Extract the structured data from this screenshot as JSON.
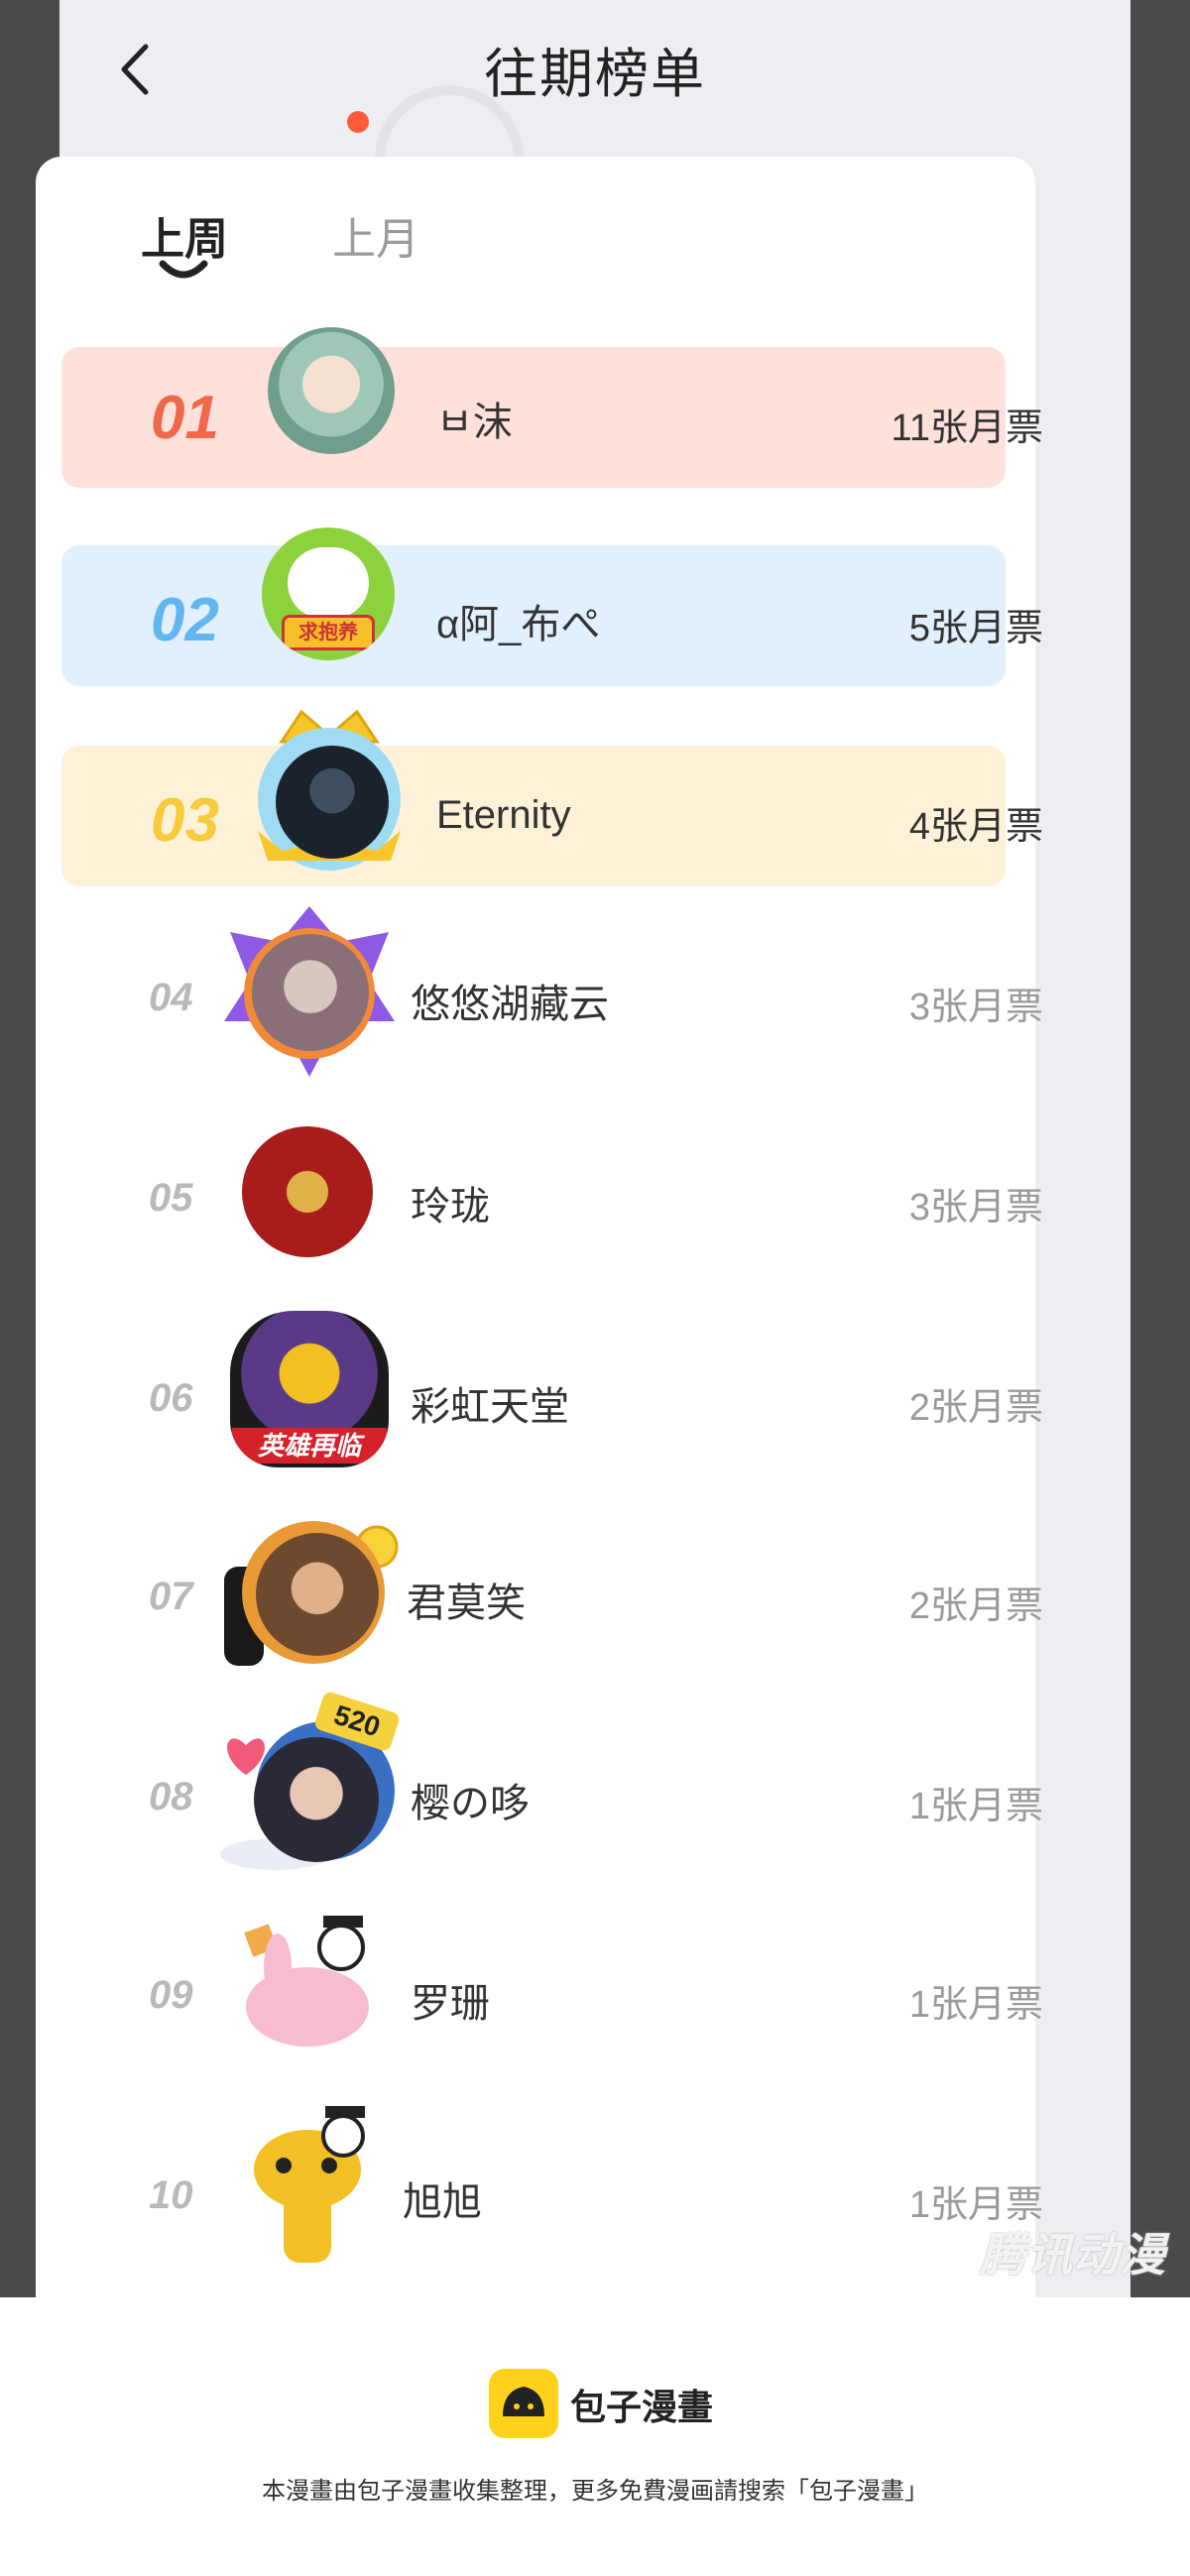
{
  "header": {
    "title": "往期榜单",
    "back_icon": "chevron-left-icon"
  },
  "tabs": [
    {
      "label": "上周",
      "selected": true
    },
    {
      "label": "上月",
      "selected": false
    }
  ],
  "ranking": [
    {
      "rank": "01",
      "name": "ㅂ沫",
      "votes": "11张月票",
      "color": "#f0684a"
    },
    {
      "rank": "02",
      "name": "α阿_布ぺ",
      "votes": "5张月票",
      "color": "#62b6f2",
      "avatar_text": "求抱养"
    },
    {
      "rank": "03",
      "name": "Eternity",
      "votes": "4张月票",
      "color": "#f8cb3c"
    },
    {
      "rank": "04",
      "name": "悠悠湖藏云",
      "votes": "3张月票"
    },
    {
      "rank": "05",
      "name": "玲珑",
      "votes": "3张月票"
    },
    {
      "rank": "06",
      "name": "彩虹天堂",
      "votes": "2张月票",
      "avatar_text": "英雄再临"
    },
    {
      "rank": "07",
      "name": "君莫笑",
      "votes": "2张月票"
    },
    {
      "rank": "08",
      "name": "樱の哆",
      "votes": "1张月票",
      "avatar_text": "520"
    },
    {
      "rank": "09",
      "name": "罗珊",
      "votes": "1张月票"
    },
    {
      "rank": "10",
      "name": "旭旭",
      "votes": "1张月票"
    }
  ],
  "watermark": "腾讯动漫",
  "footer": {
    "logo_text": "包子漫畫",
    "note": "本漫畫由包子漫畫收集整理，更多免費漫画請搜索「包子漫畫」"
  }
}
